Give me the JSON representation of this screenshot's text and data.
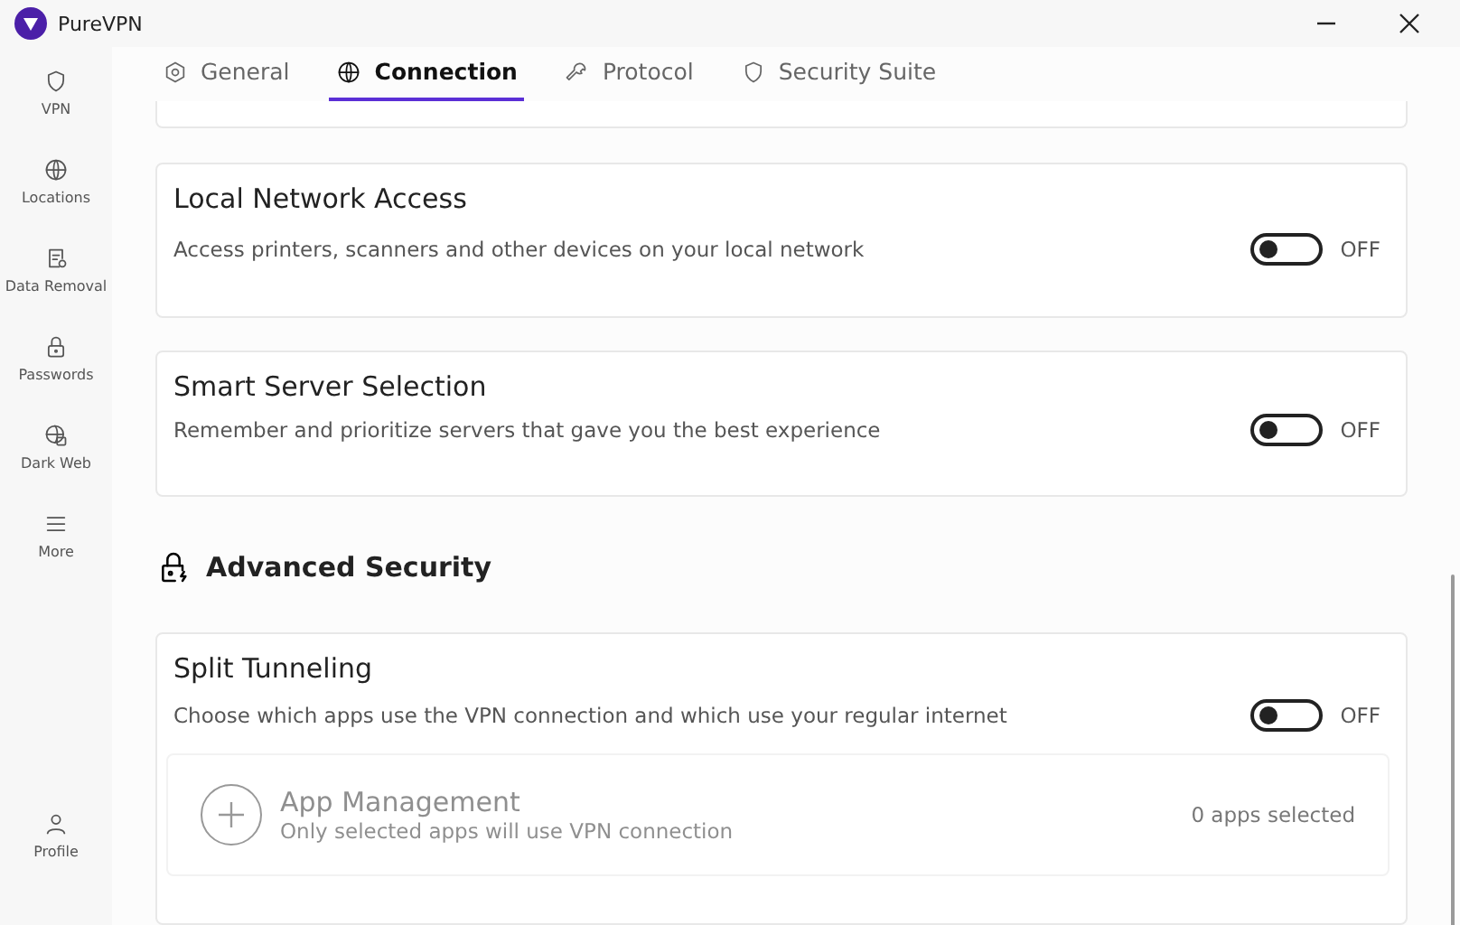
{
  "window": {
    "title": "PureVPN"
  },
  "sidebar": {
    "items": [
      {
        "label": "VPN"
      },
      {
        "label": "Locations"
      },
      {
        "label": "Data Removal"
      },
      {
        "label": "Passwords"
      },
      {
        "label": "Dark Web"
      },
      {
        "label": "More"
      }
    ],
    "profile": {
      "label": "Profile"
    }
  },
  "tabs": [
    {
      "label": "General",
      "selected": false
    },
    {
      "label": "Connection",
      "selected": true
    },
    {
      "label": "Protocol",
      "selected": false
    },
    {
      "label": "Security Suite",
      "selected": false
    }
  ],
  "settings": [
    {
      "title": "Local Network Access",
      "description": "Access printers, scanners and other devices on your local network",
      "on": false,
      "state": "OFF"
    },
    {
      "title": "Smart Server Selection",
      "description": "Remember and prioritize servers that gave you the best experience",
      "on": false,
      "state": "OFF"
    }
  ],
  "advanced_section": {
    "title": "Advanced Security"
  },
  "split_tunneling": {
    "title": "Split Tunneling",
    "description": "Choose which apps use the VPN connection and which use your regular internet",
    "on": false,
    "state": "OFF",
    "app_management": {
      "title": "App Management",
      "subtitle": "Only selected apps will use VPN connection",
      "count": "0 apps selected",
      "disabled": true
    }
  }
}
